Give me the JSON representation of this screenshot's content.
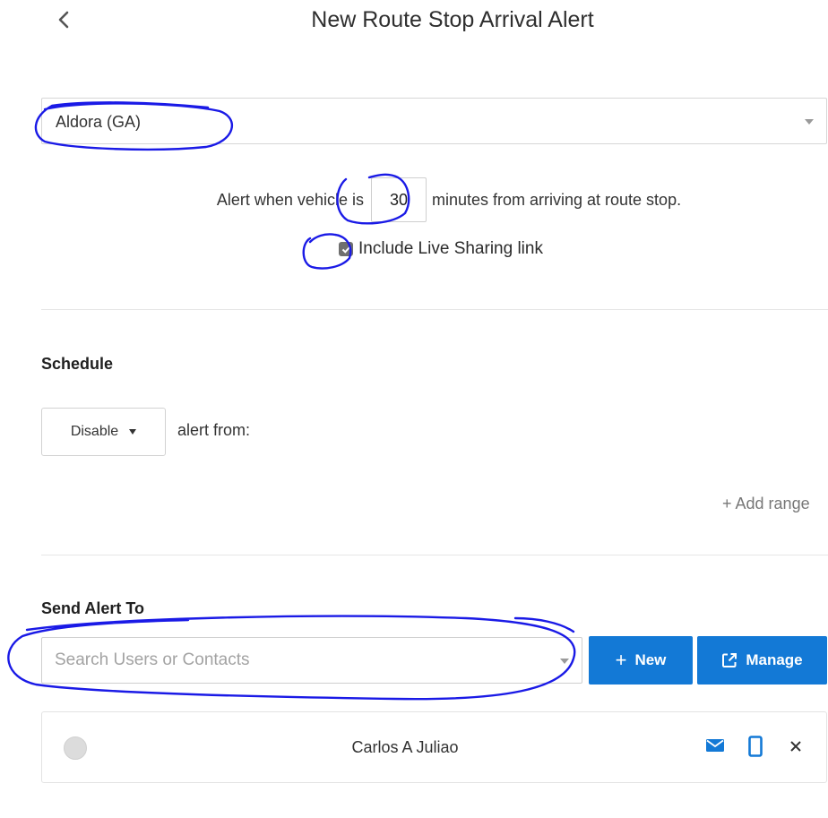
{
  "header": {
    "back_icon": "chevron-left-icon",
    "title": "New Route Stop Arrival Alert"
  },
  "route_stop": {
    "selected": "Aldora (GA)"
  },
  "alert_rule": {
    "prefix": "Alert when vehicle is",
    "minutes": "30",
    "suffix": "minutes from arriving at route stop."
  },
  "live_sharing": {
    "checked": true,
    "label": "Include Live Sharing link"
  },
  "schedule": {
    "title": "Schedule",
    "mode": "Disable",
    "alert_from": "alert from:",
    "add_range": "+ Add range"
  },
  "send_alert": {
    "title": "Send Alert To",
    "search_placeholder": "Search Users or Contacts",
    "new_button": "New",
    "manage_button": "Manage"
  },
  "recipients": [
    {
      "name": "Carlos A Juliao"
    }
  ],
  "colors": {
    "primary": "#1379d6",
    "annotation": "#1a1ae6"
  }
}
